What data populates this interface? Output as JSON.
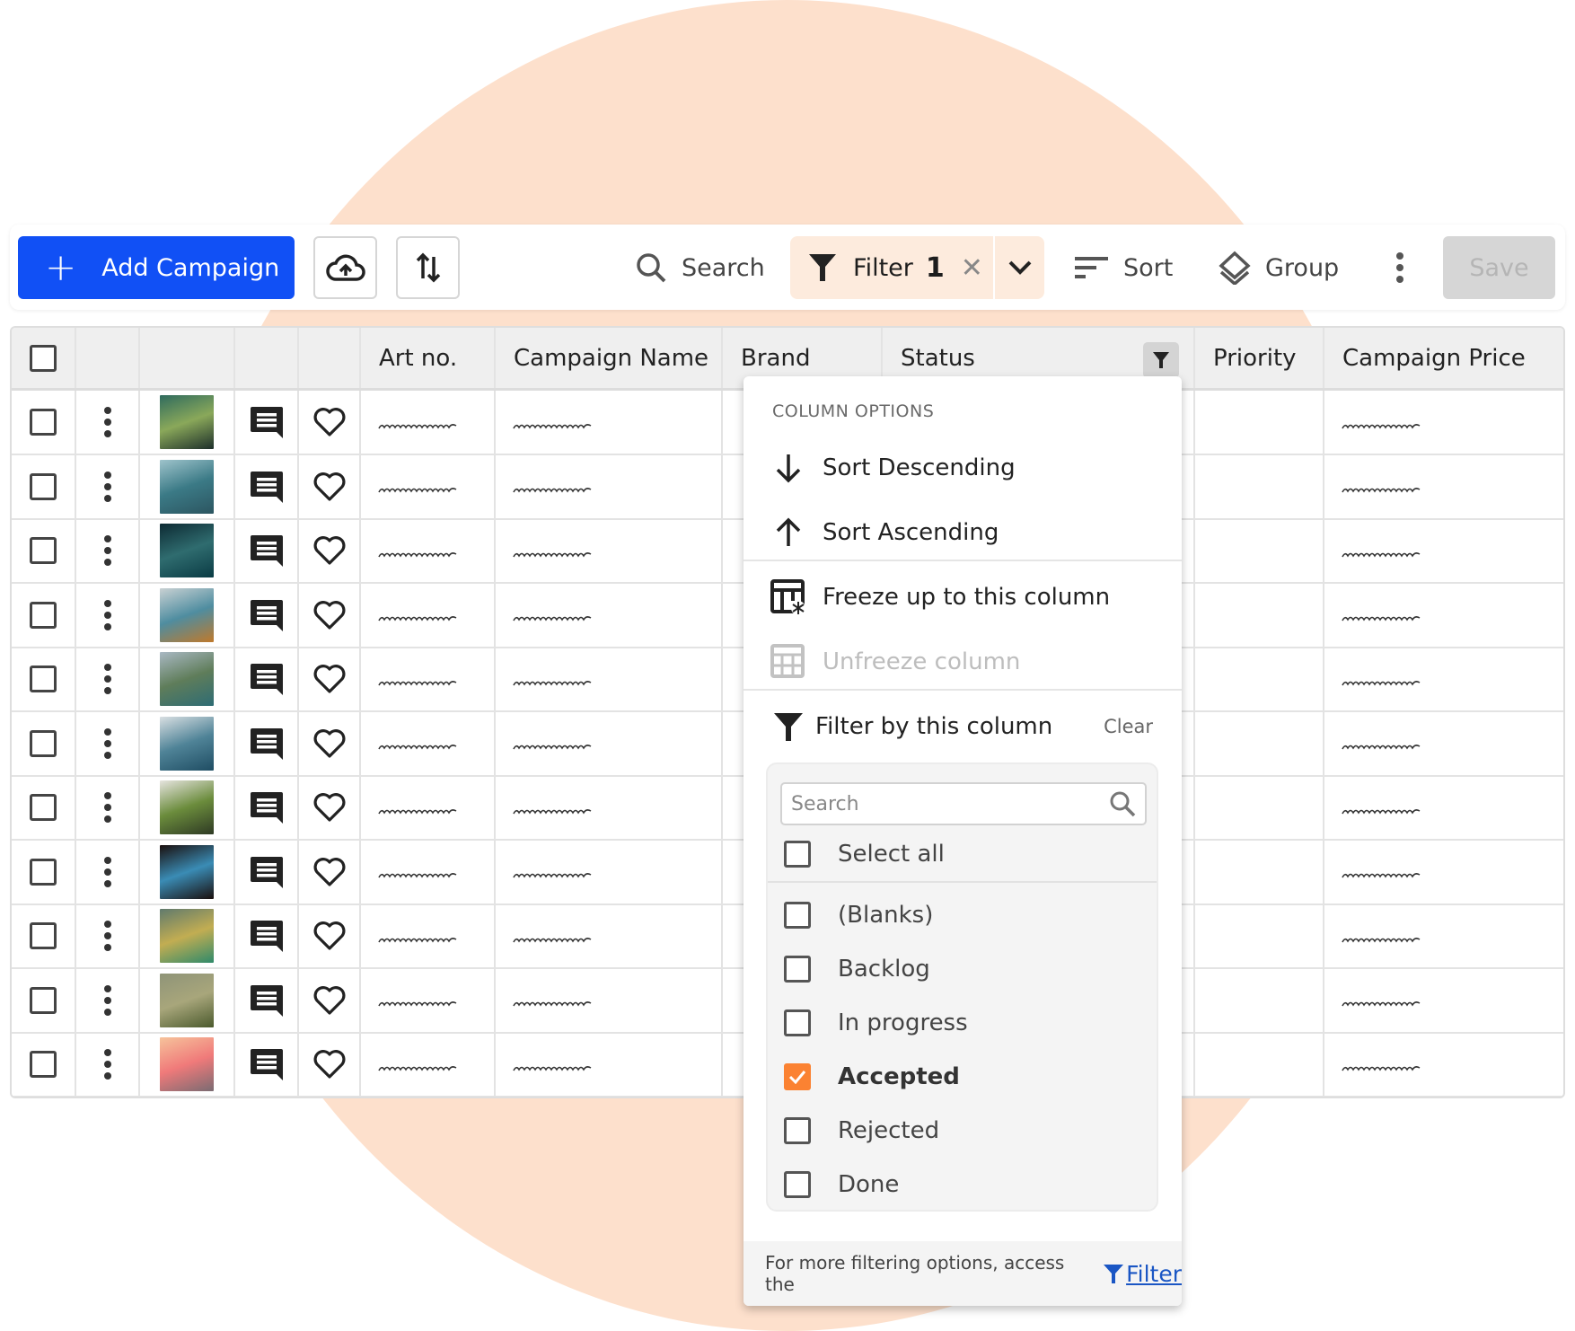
{
  "toolbar": {
    "add_label": "Add Campaign",
    "upload_icon": "cloud-upload-icon",
    "sort_arrows_icon": "sort-arrows-icon",
    "search_label": "Search",
    "filter_label": "Filter",
    "filter_count": "1",
    "sort_label": "Sort",
    "group_label": "Group",
    "save_label": "Save",
    "accent_color": "#1150f5"
  },
  "table": {
    "columns": [
      "",
      "",
      "",
      "",
      "",
      "Art no.",
      "Campaign Name",
      "Brand",
      "Status",
      "Priority",
      "Campaign Price"
    ],
    "rows": [
      {
        "thumb": "forest canopy",
        "colors": [
          "#2f6b5e",
          "#8aa85a",
          "#1d2f2a"
        ]
      },
      {
        "thumb": "mountain lake reflection",
        "colors": [
          "#9ec3cb",
          "#3b7a86",
          "#2c5560"
        ]
      },
      {
        "thumb": "milky way night sky",
        "colors": [
          "#0d2a33",
          "#2f6c6f",
          "#0a3b44"
        ]
      },
      {
        "thumb": "boat on alpine lake",
        "colors": [
          "#c9d1d3",
          "#4f8da0",
          "#c0792b"
        ]
      },
      {
        "thumb": "lake with pine trees",
        "colors": [
          "#a9b8c3",
          "#5f7d5a",
          "#2e6c74"
        ]
      },
      {
        "thumb": "ocean waves",
        "colors": [
          "#d9dfe2",
          "#4f8397",
          "#1f4d63"
        ]
      },
      {
        "thumb": "mountain meadow",
        "colors": [
          "#e6e4df",
          "#6b8c3c",
          "#2e3a24"
        ]
      },
      {
        "thumb": "canyon river",
        "colors": [
          "#1a0f0d",
          "#3a8cb5",
          "#1a0f0d"
        ]
      },
      {
        "thumb": "island in misty lake",
        "colors": [
          "#607a6d",
          "#c2ad52",
          "#2f8a6a"
        ]
      },
      {
        "thumb": "foggy valley",
        "colors": [
          "#8f9478",
          "#a8a67b",
          "#4b5a2d"
        ]
      },
      {
        "thumb": "peak above clouds at sunset",
        "colors": [
          "#f6c39b",
          "#f07a7a",
          "#7a6b72"
        ]
      }
    ]
  },
  "dropdown": {
    "header": "COLUMN OPTIONS",
    "sort_desc": "Sort Descending",
    "sort_asc": "Sort Ascending",
    "freeze": "Freeze up to this column",
    "unfreeze": "Unfreeze column",
    "filter_by": "Filter by this column",
    "clear": "Clear",
    "search_placeholder": "Search",
    "options": [
      {
        "label": "Select all",
        "checked": false
      },
      {
        "label": "(Blanks)",
        "checked": false
      },
      {
        "label": "Backlog",
        "checked": false
      },
      {
        "label": "In progress",
        "checked": false
      },
      {
        "label": "Accepted",
        "checked": true
      },
      {
        "label": "Rejected",
        "checked": false
      },
      {
        "label": "Done",
        "checked": false
      }
    ],
    "footer_text": "For more filtering options, access the",
    "footer_link": "Filter",
    "checked_color": "#fb8232",
    "link_color": "#1a56c4"
  }
}
